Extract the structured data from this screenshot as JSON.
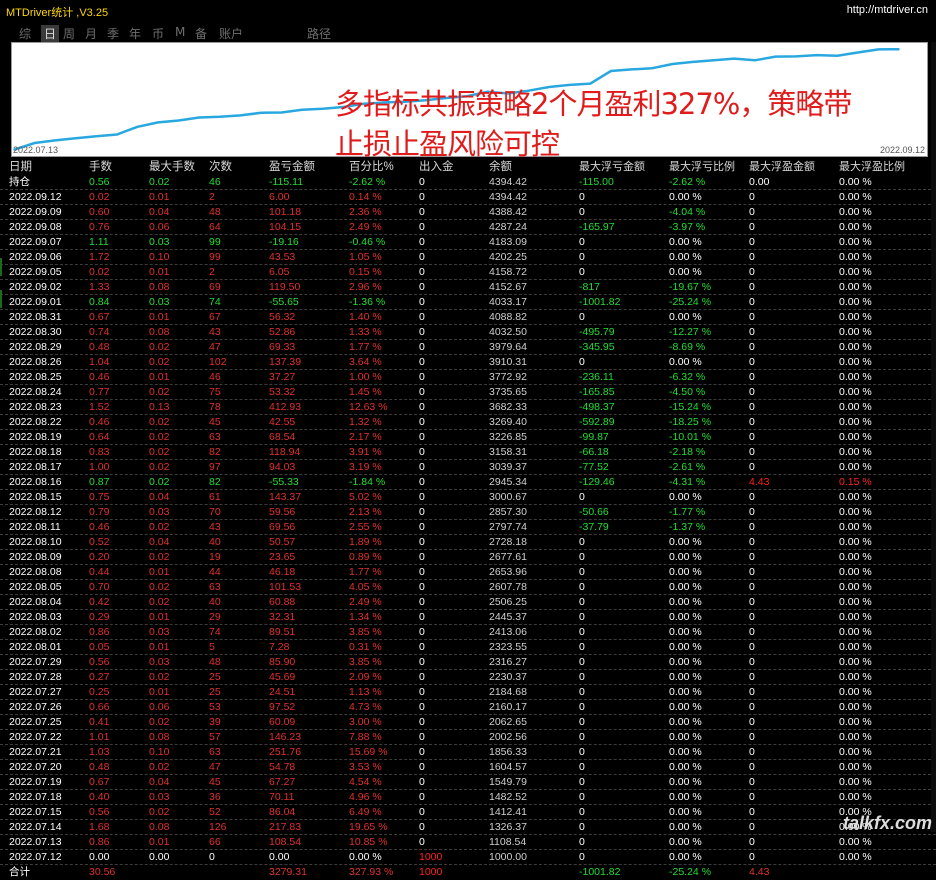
{
  "app": {
    "title": "MTDriver统计 ,V3.25",
    "url": "http://mtdriver.cn"
  },
  "tabs": [
    "综",
    "日",
    "周",
    "月",
    "季",
    "年",
    "币",
    "M",
    "备",
    "账户",
    "路径"
  ],
  "active_tab": 1,
  "overlay": {
    "line1": "多指标共振策略2个月盈利327%，策略带",
    "line2": "止损止盈风险可控"
  },
  "chart_labels": {
    "start": "2022.07.13",
    "end": "2022.09.12"
  },
  "chart_data": {
    "type": "line",
    "x": [
      "2022.07.13",
      "2022.07.14",
      "2022.07.15",
      "2022.07.18",
      "2022.07.19",
      "2022.07.20",
      "2022.07.21",
      "2022.07.22",
      "2022.07.25",
      "2022.07.26",
      "2022.07.27",
      "2022.07.28",
      "2022.07.29",
      "2022.08.01",
      "2022.08.02",
      "2022.08.03",
      "2022.08.04",
      "2022.08.05",
      "2022.08.08",
      "2022.08.09",
      "2022.08.10",
      "2022.08.11",
      "2022.08.12",
      "2022.08.15",
      "2022.08.16",
      "2022.08.17",
      "2022.08.18",
      "2022.08.19",
      "2022.08.22",
      "2022.08.23",
      "2022.08.24",
      "2022.08.25",
      "2022.08.26",
      "2022.08.29",
      "2022.08.30",
      "2022.08.31",
      "2022.09.01",
      "2022.09.02",
      "2022.09.05",
      "2022.09.06",
      "2022.09.07",
      "2022.09.08",
      "2022.09.09",
      "2022.09.12"
    ],
    "y": [
      1108.54,
      1326.37,
      1412.41,
      1482.52,
      1549.79,
      1604.57,
      1856.33,
      2002.56,
      2062.65,
      2160.17,
      2184.68,
      2230.37,
      2316.27,
      2323.55,
      2413.06,
      2445.37,
      2506.25,
      2607.78,
      2653.96,
      2677.61,
      2728.18,
      2797.74,
      2857.3,
      3000.67,
      2945.34,
      3039.37,
      3158.31,
      3226.85,
      3269.4,
      3682.33,
      3735.65,
      3772.92,
      3910.31,
      3979.64,
      4032.5,
      4088.82,
      4033.17,
      4152.67,
      4158.72,
      4202.25,
      4183.09,
      4287.24,
      4388.42,
      4394.42
    ],
    "ylim": [
      1000,
      4500
    ],
    "color": "#29a8e0"
  },
  "colors": {
    "header": "#d8d8d8",
    "neutral": "#ffffff",
    "pos": "#e03030",
    "neg": "#22dd33",
    "amount": "#d0d0d0",
    "flow": "#ff2020"
  },
  "headers": [
    "日期",
    "手数",
    "最大手数",
    "次数",
    "盈亏金额",
    "百分比%",
    "出入金",
    "余额",
    "最大浮亏金额",
    "最大浮亏比例",
    "最大浮盈金额",
    "最大浮盈比例"
  ],
  "rows": [
    {
      "c": [
        "持仓",
        "0.56",
        "0.02",
        "46",
        "-115.11",
        "-2.62 %",
        "0",
        "4394.42",
        "-115.00",
        "-2.62 %",
        "0.00",
        "0.00 %"
      ],
      "s": "neg",
      "special": "open"
    },
    {
      "c": [
        "2022.09.12",
        "0.02",
        "0.01",
        "2",
        "6.00",
        "0.14 %",
        "0",
        "4394.42",
        "0",
        "0.00 %",
        "0",
        "0.00 %"
      ],
      "s": "pos"
    },
    {
      "c": [
        "2022.09.09",
        "0.60",
        "0.04",
        "48",
        "101.18",
        "2.36 %",
        "0",
        "4388.42",
        "0",
        "-4.04 %",
        "0",
        "0.00 %"
      ],
      "s": "pos"
    },
    {
      "c": [
        "2022.09.08",
        "0.76",
        "0.06",
        "64",
        "104.15",
        "2.49 %",
        "0",
        "4287.24",
        "-165.97",
        "-3.97 %",
        "0",
        "0.00 %"
      ],
      "s": "pos"
    },
    {
      "c": [
        "2022.09.07",
        "1.11",
        "0.03",
        "99",
        "-19.16",
        "-0.46 %",
        "0",
        "4183.09",
        "0",
        "0.00 %",
        "0",
        "0.00 %"
      ],
      "s": "neg"
    },
    {
      "c": [
        "2022.09.06",
        "1.72",
        "0.10",
        "99",
        "43.53",
        "1.05 %",
        "0",
        "4202.25",
        "0",
        "0.00 %",
        "0",
        "0.00 %"
      ],
      "s": "pos"
    },
    {
      "c": [
        "2022.09.05",
        "0.02",
        "0.01",
        "2",
        "6.05",
        "0.15 %",
        "0",
        "4158.72",
        "0",
        "0.00 %",
        "0",
        "0.00 %"
      ],
      "s": "pos"
    },
    {
      "c": [
        "2022.09.02",
        "1.33",
        "0.08",
        "69",
        "119.50",
        "2.96 %",
        "0",
        "4152.67",
        "-817",
        "-19.67 %",
        "0",
        "0.00 %"
      ],
      "s": "pos"
    },
    {
      "c": [
        "2022.09.01",
        "0.84",
        "0.03",
        "74",
        "-55.65",
        "-1.36 %",
        "0",
        "4033.17",
        "-1001.82",
        "-25.24 %",
        "0",
        "0.00 %"
      ],
      "s": "neg"
    },
    {
      "c": [
        "2022.08.31",
        "0.67",
        "0.01",
        "67",
        "56.32",
        "1.40 %",
        "0",
        "4088.82",
        "0",
        "0.00 %",
        "0",
        "0.00 %"
      ],
      "s": "pos"
    },
    {
      "c": [
        "2022.08.30",
        "0.74",
        "0.08",
        "43",
        "52.86",
        "1.33 %",
        "0",
        "4032.50",
        "-495.79",
        "-12.27 %",
        "0",
        "0.00 %"
      ],
      "s": "pos"
    },
    {
      "c": [
        "2022.08.29",
        "0.48",
        "0.02",
        "47",
        "69.33",
        "1.77 %",
        "0",
        "3979.64",
        "-345.95",
        "-8.69 %",
        "0",
        "0.00 %"
      ],
      "s": "pos"
    },
    {
      "c": [
        "2022.08.26",
        "1.04",
        "0.02",
        "102",
        "137.39",
        "3.64 %",
        "0",
        "3910.31",
        "0",
        "0.00 %",
        "0",
        "0.00 %"
      ],
      "s": "pos"
    },
    {
      "c": [
        "2022.08.25",
        "0.46",
        "0.01",
        "46",
        "37.27",
        "1.00 %",
        "0",
        "3772.92",
        "-236.11",
        "-6.32 %",
        "0",
        "0.00 %"
      ],
      "s": "pos"
    },
    {
      "c": [
        "2022.08.24",
        "0.77",
        "0.02",
        "75",
        "53.32",
        "1.45 %",
        "0",
        "3735.65",
        "-165.85",
        "-4.50 %",
        "0",
        "0.00 %"
      ],
      "s": "pos"
    },
    {
      "c": [
        "2022.08.23",
        "1.52",
        "0.13",
        "78",
        "412.93",
        "12.63 %",
        "0",
        "3682.33",
        "-498.37",
        "-15.24 %",
        "0",
        "0.00 %"
      ],
      "s": "pos"
    },
    {
      "c": [
        "2022.08.22",
        "0.46",
        "0.02",
        "45",
        "42.55",
        "1.32 %",
        "0",
        "3269.40",
        "-592.89",
        "-18.25 %",
        "0",
        "0.00 %"
      ],
      "s": "pos"
    },
    {
      "c": [
        "2022.08.19",
        "0.64",
        "0.02",
        "63",
        "68.54",
        "2.17 %",
        "0",
        "3226.85",
        "-99.87",
        "-10.01 %",
        "0",
        "0.00 %"
      ],
      "s": "pos"
    },
    {
      "c": [
        "2022.08.18",
        "0.83",
        "0.02",
        "82",
        "118.94",
        "3.91 %",
        "0",
        "3158.31",
        "-66.18",
        "-2.18 %",
        "0",
        "0.00 %"
      ],
      "s": "pos"
    },
    {
      "c": [
        "2022.08.17",
        "1.00",
        "0.02",
        "97",
        "94.03",
        "3.19 %",
        "0",
        "3039.37",
        "-77.52",
        "-2.61 %",
        "0",
        "0.00 %"
      ],
      "s": "pos"
    },
    {
      "c": [
        "2022.08.16",
        "0.87",
        "0.02",
        "82",
        "-55.33",
        "-1.84 %",
        "0",
        "2945.34",
        "-129.46",
        "-4.31 %",
        "4.43",
        "0.15 %"
      ],
      "s": "neg",
      "special": "float"
    },
    {
      "c": [
        "2022.08.15",
        "0.75",
        "0.04",
        "61",
        "143.37",
        "5.02 %",
        "0",
        "3000.67",
        "0",
        "0.00 %",
        "0",
        "0.00 %"
      ],
      "s": "pos"
    },
    {
      "c": [
        "2022.08.12",
        "0.79",
        "0.03",
        "70",
        "59.56",
        "2.13 %",
        "0",
        "2857.30",
        "-50.66",
        "-1.77 %",
        "0",
        "0.00 %"
      ],
      "s": "pos"
    },
    {
      "c": [
        "2022.08.11",
        "0.46",
        "0.02",
        "43",
        "69.56",
        "2.55 %",
        "0",
        "2797.74",
        "-37.79",
        "-1.37 %",
        "0",
        "0.00 %"
      ],
      "s": "pos"
    },
    {
      "c": [
        "2022.08.10",
        "0.52",
        "0.04",
        "40",
        "50.57",
        "1.89 %",
        "0",
        "2728.18",
        "0",
        "0.00 %",
        "0",
        "0.00 %"
      ],
      "s": "pos"
    },
    {
      "c": [
        "2022.08.09",
        "0.20",
        "0.02",
        "19",
        "23.65",
        "0.89 %",
        "0",
        "2677.61",
        "0",
        "0.00 %",
        "0",
        "0.00 %"
      ],
      "s": "pos"
    },
    {
      "c": [
        "2022.08.08",
        "0.44",
        "0.01",
        "44",
        "46.18",
        "1.77 %",
        "0",
        "2653.96",
        "0",
        "0.00 %",
        "0",
        "0.00 %"
      ],
      "s": "pos"
    },
    {
      "c": [
        "2022.08.05",
        "0.70",
        "0.02",
        "63",
        "101.53",
        "4.05 %",
        "0",
        "2607.78",
        "0",
        "0.00 %",
        "0",
        "0.00 %"
      ],
      "s": "pos"
    },
    {
      "c": [
        "2022.08.04",
        "0.42",
        "0.02",
        "40",
        "60.88",
        "2.49 %",
        "0",
        "2506.25",
        "0",
        "0.00 %",
        "0",
        "0.00 %"
      ],
      "s": "pos"
    },
    {
      "c": [
        "2022.08.03",
        "0.29",
        "0.01",
        "29",
        "32.31",
        "1.34 %",
        "0",
        "2445.37",
        "0",
        "0.00 %",
        "0",
        "0.00 %"
      ],
      "s": "pos"
    },
    {
      "c": [
        "2022.08.02",
        "0.86",
        "0.03",
        "74",
        "89.51",
        "3.85 %",
        "0",
        "2413.06",
        "0",
        "0.00 %",
        "0",
        "0.00 %"
      ],
      "s": "pos"
    },
    {
      "c": [
        "2022.08.01",
        "0.05",
        "0.01",
        "5",
        "7.28",
        "0.31 %",
        "0",
        "2323.55",
        "0",
        "0.00 %",
        "0",
        "0.00 %"
      ],
      "s": "pos"
    },
    {
      "c": [
        "2022.07.29",
        "0.56",
        "0.03",
        "48",
        "85.90",
        "3.85 %",
        "0",
        "2316.27",
        "0",
        "0.00 %",
        "0",
        "0.00 %"
      ],
      "s": "pos"
    },
    {
      "c": [
        "2022.07.28",
        "0.27",
        "0.02",
        "25",
        "45.69",
        "2.09 %",
        "0",
        "2230.37",
        "0",
        "0.00 %",
        "0",
        "0.00 %"
      ],
      "s": "pos"
    },
    {
      "c": [
        "2022.07.27",
        "0.25",
        "0.01",
        "25",
        "24.51",
        "1.13 %",
        "0",
        "2184.68",
        "0",
        "0.00 %",
        "0",
        "0.00 %"
      ],
      "s": "pos"
    },
    {
      "c": [
        "2022.07.26",
        "0.66",
        "0.06",
        "53",
        "97.52",
        "4.73 %",
        "0",
        "2160.17",
        "0",
        "0.00 %",
        "0",
        "0.00 %"
      ],
      "s": "pos"
    },
    {
      "c": [
        "2022.07.25",
        "0.41",
        "0.02",
        "39",
        "60.09",
        "3.00 %",
        "0",
        "2062.65",
        "0",
        "0.00 %",
        "0",
        "0.00 %"
      ],
      "s": "pos"
    },
    {
      "c": [
        "2022.07.22",
        "1.01",
        "0.08",
        "57",
        "146.23",
        "7.88 %",
        "0",
        "2002.56",
        "0",
        "0.00 %",
        "0",
        "0.00 %"
      ],
      "s": "pos"
    },
    {
      "c": [
        "2022.07.21",
        "1.03",
        "0.10",
        "63",
        "251.76",
        "15.69 %",
        "0",
        "1856.33",
        "0",
        "0.00 %",
        "0",
        "0.00 %"
      ],
      "s": "pos"
    },
    {
      "c": [
        "2022.07.20",
        "0.48",
        "0.02",
        "47",
        "54.78",
        "3.53 %",
        "0",
        "1604.57",
        "0",
        "0.00 %",
        "0",
        "0.00 %"
      ],
      "s": "pos"
    },
    {
      "c": [
        "2022.07.19",
        "0.67",
        "0.04",
        "45",
        "67.27",
        "4.54 %",
        "0",
        "1549.79",
        "0",
        "0.00 %",
        "0",
        "0.00 %"
      ],
      "s": "pos"
    },
    {
      "c": [
        "2022.07.18",
        "0.40",
        "0.03",
        "36",
        "70.11",
        "4.96 %",
        "0",
        "1482.52",
        "0",
        "0.00 %",
        "0",
        "0.00 %"
      ],
      "s": "pos"
    },
    {
      "c": [
        "2022.07.15",
        "0.56",
        "0.02",
        "52",
        "86.04",
        "6.49 %",
        "0",
        "1412.41",
        "0",
        "0.00 %",
        "0",
        "0.00 %"
      ],
      "s": "pos"
    },
    {
      "c": [
        "2022.07.14",
        "1.68",
        "0.08",
        "126",
        "217.83",
        "19.65 %",
        "0",
        "1326.37",
        "0",
        "0.00 %",
        "0",
        "0.00 %"
      ],
      "s": "pos"
    },
    {
      "c": [
        "2022.07.13",
        "0.86",
        "0.01",
        "66",
        "108.54",
        "10.85 %",
        "0",
        "1108.54",
        "0",
        "0.00 %",
        "0",
        "0.00 %"
      ],
      "s": "pos"
    },
    {
      "c": [
        "2022.07.12",
        "0.00",
        "0.00",
        "0",
        "0.00",
        "0.00 %",
        "1000",
        "1000.00",
        "0",
        "0.00 %",
        "0",
        "0.00 %"
      ],
      "s": "neutral",
      "special": "deposit"
    }
  ],
  "total": {
    "c": [
      "合计",
      "30.56",
      "",
      "",
      "3279.31",
      "327.93 %",
      "1000",
      "",
      "-1001.82",
      "-25.24 %",
      "4.43",
      ""
    ]
  },
  "watermark": "talkfx.com"
}
